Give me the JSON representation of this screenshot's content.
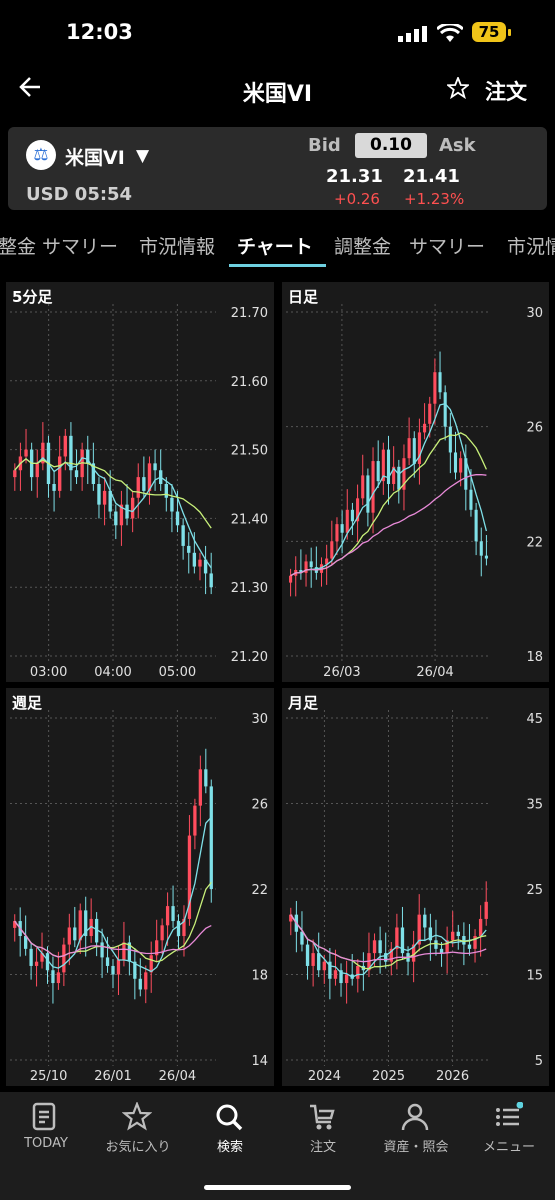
{
  "status_bar": {
    "time": "12:03",
    "battery": "75"
  },
  "header": {
    "title": "米国VI",
    "order_label": "注文"
  },
  "quote": {
    "name": "米国VI",
    "caret": "▼",
    "time": "USD 05:54",
    "bid_label": "Bid",
    "ask_label": "Ask",
    "spread": "0.10",
    "bid": "21.31",
    "ask": "21.41",
    "change": "+0.26",
    "change_pct": "+1.23%",
    "colors": {
      "up": "#ff4d5e",
      "down": "#7fe0e8",
      "ma_short": "#7fe0e8",
      "ma_mid": "#c8f07a",
      "ma_long": "#e88ad8"
    }
  },
  "tabs": [
    "整金",
    "サマリー",
    "市況情報",
    "チャート",
    "調整金",
    "サマリー",
    "市況情"
  ],
  "active_tab": "チャート",
  "charts": [
    {
      "title": "5分足",
      "type": "candlestick",
      "y_ticks": [
        "21.70",
        "21.60",
        "21.50",
        "21.40",
        "21.30",
        "21.20"
      ],
      "y_tick_values": [
        21.7,
        21.6,
        21.5,
        21.4,
        21.3,
        21.2
      ],
      "x_ticks": [
        "03:00",
        "04:00",
        "05:00"
      ],
      "candles": [
        21.47,
        21.49,
        21.5,
        21.46,
        21.48,
        21.51,
        21.45,
        21.44,
        21.49,
        21.52,
        21.47,
        21.46,
        21.5,
        21.48,
        21.45,
        21.42,
        21.44,
        21.41,
        21.39,
        21.42,
        21.4,
        21.43,
        21.46,
        21.44,
        21.48,
        21.47,
        21.45,
        21.43,
        21.41,
        21.39,
        21.36,
        21.35,
        21.33,
        21.34,
        21.32,
        21.3
      ],
      "last": 21.31
    },
    {
      "title": "日足",
      "type": "candlestick",
      "y_ticks": [
        "30",
        "26",
        "22",
        "18"
      ],
      "y_tick_values": [
        30,
        26,
        22,
        18
      ],
      "x_ticks": [
        "26/03",
        "26/04"
      ],
      "candles": [
        20.8,
        21.0,
        20.9,
        21.3,
        21.1,
        20.9,
        21.2,
        21.4,
        22.0,
        22.6,
        22.3,
        23.1,
        22.7,
        23.5,
        24.3,
        23.0,
        24.8,
        24.1,
        25.2,
        24.0,
        24.6,
        23.8,
        24.9,
        25.6,
        24.7,
        25.8,
        26.1,
        26.8,
        27.9,
        27.2,
        26.0,
        25.1,
        24.4,
        24.9,
        23.8,
        23.1,
        22.0,
        21.5,
        21.4
      ],
      "last": 21.4
    },
    {
      "title": "週足",
      "type": "candlestick",
      "y_ticks": [
        "30",
        "26",
        "22",
        "18",
        "14"
      ],
      "y_tick_values": [
        30,
        26,
        22,
        18,
        14
      ],
      "x_ticks": [
        "25/10",
        "26/01",
        "26/04"
      ],
      "candles": [
        20.5,
        19.8,
        19.2,
        18.4,
        18.6,
        19.0,
        18.2,
        17.6,
        18.1,
        19.4,
        20.2,
        19.6,
        21.0,
        19.8,
        20.6,
        19.5,
        18.8,
        18.4,
        18.0,
        18.7,
        19.5,
        18.6,
        17.8,
        17.3,
        18.1,
        18.9,
        19.6,
        20.3,
        21.2,
        20.5,
        19.8,
        20.6,
        24.5,
        25.9,
        27.6,
        26.8,
        22.0
      ],
      "last": 22.0
    },
    {
      "title": "月足",
      "type": "candlestick",
      "y_ticks": [
        "45",
        "35",
        "25",
        "15",
        "5"
      ],
      "y_tick_values": [
        45,
        35,
        25,
        15,
        5
      ],
      "x_ticks": [
        "2024",
        "2025",
        "2026"
      ],
      "candles": [
        22.0,
        20.0,
        18.5,
        16.0,
        17.5,
        15.5,
        16.5,
        14.5,
        15.5,
        14.0,
        15.0,
        14.5,
        16.0,
        15.5,
        17.5,
        19.0,
        17.5,
        16.5,
        18.0,
        20.5,
        17.5,
        16.5,
        18.5,
        22.0,
        20.5,
        19.0,
        18.0,
        17.5,
        19.0,
        20.0,
        19.5,
        18.5,
        18.0,
        19.5,
        21.5,
        23.5
      ],
      "last": 23.5
    }
  ],
  "bottom_nav": [
    {
      "label": "TODAY",
      "icon": "document-icon"
    },
    {
      "label": "お気に入り",
      "icon": "star-icon"
    },
    {
      "label": "検索",
      "icon": "search-icon"
    },
    {
      "label": "注文",
      "icon": "cart-icon"
    },
    {
      "label": "資産・照会",
      "icon": "person-icon"
    },
    {
      "label": "メニュー",
      "icon": "menu-icon"
    }
  ]
}
